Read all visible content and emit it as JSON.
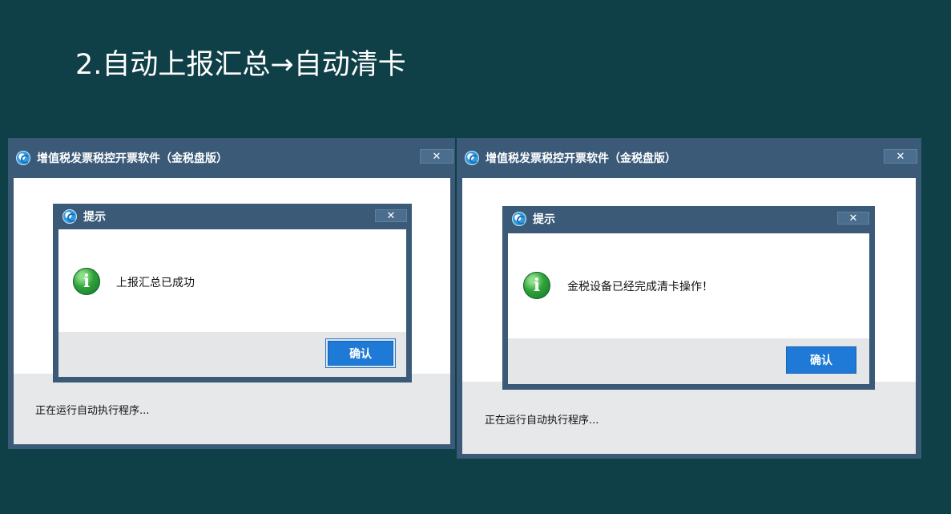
{
  "slide": {
    "title": "2.自动上报汇总→自动清卡"
  },
  "windows": [
    {
      "title": "增值税发票税控开票软件（金税盘版）",
      "close": "✕",
      "status": "正在运行自动执行程序...",
      "dialog": {
        "title": "提示",
        "close": "✕",
        "icon_glyph": "i",
        "message": "上报汇总已成功",
        "ok_label": "确认"
      }
    },
    {
      "title": "增值税发票税控开票软件（金税盘版）",
      "close": "✕",
      "status": "正在运行自动执行程序...",
      "dialog": {
        "title": "提示",
        "close": "✕",
        "icon_glyph": "i",
        "message": "金税设备已经完成清卡操作！",
        "ok_label": "确认"
      }
    }
  ]
}
